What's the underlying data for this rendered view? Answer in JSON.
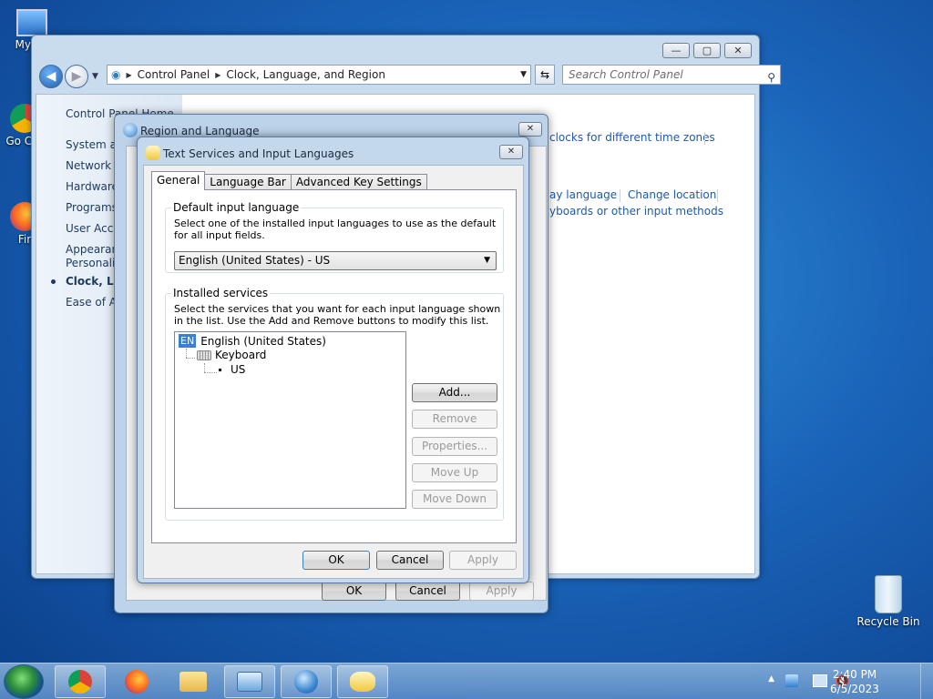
{
  "desktop": {
    "icons": [
      {
        "label": "My Co",
        "icon": "computer-icon"
      },
      {
        "label": "Go Chr",
        "icon": "chrome-icon"
      },
      {
        "label": "Fir",
        "icon": "firefox-icon"
      },
      {
        "label": "Recycle Bin",
        "icon": "recycle-bin-icon"
      }
    ]
  },
  "control_panel": {
    "address": [
      "Control Panel",
      "Clock, Language, and Region"
    ],
    "search_placeholder": "Search Control Panel",
    "sidebar": {
      "home": "Control Panel Home",
      "items": [
        "System an",
        "Network a",
        "Hardware",
        "Programs",
        "User Acco",
        "Appearanc",
        "Personaliz",
        "Clock, Lan",
        "Ease of Ac"
      ]
    },
    "links": [
      "clocks for different time zones",
      "ay language",
      "Change location",
      "yboards or other input methods"
    ]
  },
  "region_dialog": {
    "title": "Region and Language",
    "ok": "OK",
    "cancel": "Cancel",
    "apply": "Apply"
  },
  "text_services_dialog": {
    "title": "Text Services and Input Languages",
    "tabs": [
      "General",
      "Language Bar",
      "Advanced Key Settings"
    ],
    "default_input": {
      "label": "Default input language",
      "description": "Select one of the installed input languages to use as the default for all input fields.",
      "selected": "English (United States) - US"
    },
    "installed": {
      "label": "Installed services",
      "description": "Select the services that you want for each input language shown in the list. Use the Add and Remove buttons to modify this list.",
      "badge": "EN",
      "language": "English (United States)",
      "category": "Keyboard",
      "layout": "US"
    },
    "side_buttons": [
      "Add...",
      "Remove",
      "Properties...",
      "Move Up",
      "Move Down"
    ],
    "ok": "OK",
    "cancel": "Cancel",
    "apply": "Apply"
  },
  "taskbar": {
    "time": "2:40 PM",
    "date": "6/5/2023"
  },
  "colors": {
    "link": "#1e5aa8",
    "accent": "#3c7fd1"
  }
}
